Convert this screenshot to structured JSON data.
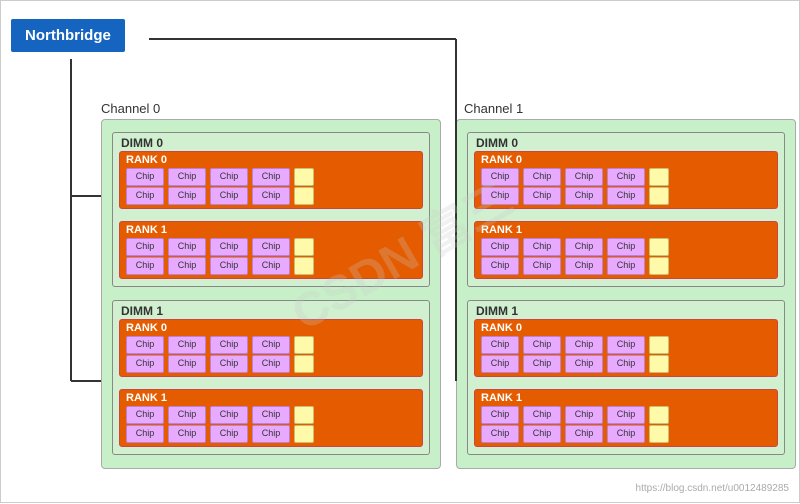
{
  "northbridge": {
    "label": "Northbridge"
  },
  "channels": [
    {
      "label": "Channel 0",
      "dimms": [
        {
          "label": "DIMM 0",
          "ranks": [
            {
              "label": "RANK 0",
              "rows": [
                [
                  "Chip",
                  "Chip",
                  "Chip",
                  "Chip"
                ],
                [
                  "Chip",
                  "Chip",
                  "Chip",
                  "Chip"
                ]
              ]
            },
            {
              "label": "RANK 1",
              "rows": [
                [
                  "Chip",
                  "Chip",
                  "Chip",
                  "Chip"
                ],
                [
                  "Chip",
                  "Chip",
                  "Chip",
                  "Chip"
                ]
              ]
            }
          ]
        },
        {
          "label": "DIMM 1",
          "ranks": [
            {
              "label": "RANK 0",
              "rows": [
                [
                  "Chip",
                  "Chip",
                  "Chip",
                  "Chip"
                ],
                [
                  "Chip",
                  "Chip",
                  "Chip",
                  "Chip"
                ]
              ]
            },
            {
              "label": "RANK 1",
              "rows": [
                [
                  "Chip",
                  "Chip",
                  "Chip",
                  "Chip"
                ],
                [
                  "Chip",
                  "Chip",
                  "Chip",
                  "Chip"
                ]
              ]
            }
          ]
        }
      ]
    },
    {
      "label": "Channel 1",
      "dimms": [
        {
          "label": "DIMM 0",
          "ranks": [
            {
              "label": "RANK 0",
              "rows": [
                [
                  "Chip",
                  "Chip",
                  "Chip",
                  "Chip"
                ],
                [
                  "Chip",
                  "Chip",
                  "Chip",
                  "Chip"
                ]
              ]
            },
            {
              "label": "RANK 1",
              "rows": [
                [
                  "Chip",
                  "Chip",
                  "Chip",
                  "Chip"
                ],
                [
                  "Chip",
                  "Chip",
                  "Chip",
                  "Chip"
                ]
              ]
            }
          ]
        },
        {
          "label": "DIMM 1",
          "ranks": [
            {
              "label": "RANK 0",
              "rows": [
                [
                  "Chip",
                  "Chip",
                  "Chip",
                  "Chip"
                ],
                [
                  "Chip",
                  "Chip",
                  "Chip",
                  "Chip"
                ]
              ]
            },
            {
              "label": "RANK 1",
              "rows": [
                [
                  "Chip",
                  "Chip",
                  "Chip",
                  "Chip"
                ],
                [
                  "Chip",
                  "Chip",
                  "Chip",
                  "Chip"
                ]
              ]
            }
          ]
        }
      ]
    }
  ],
  "watermark": "https://blog.csdn.net/u0012489285"
}
